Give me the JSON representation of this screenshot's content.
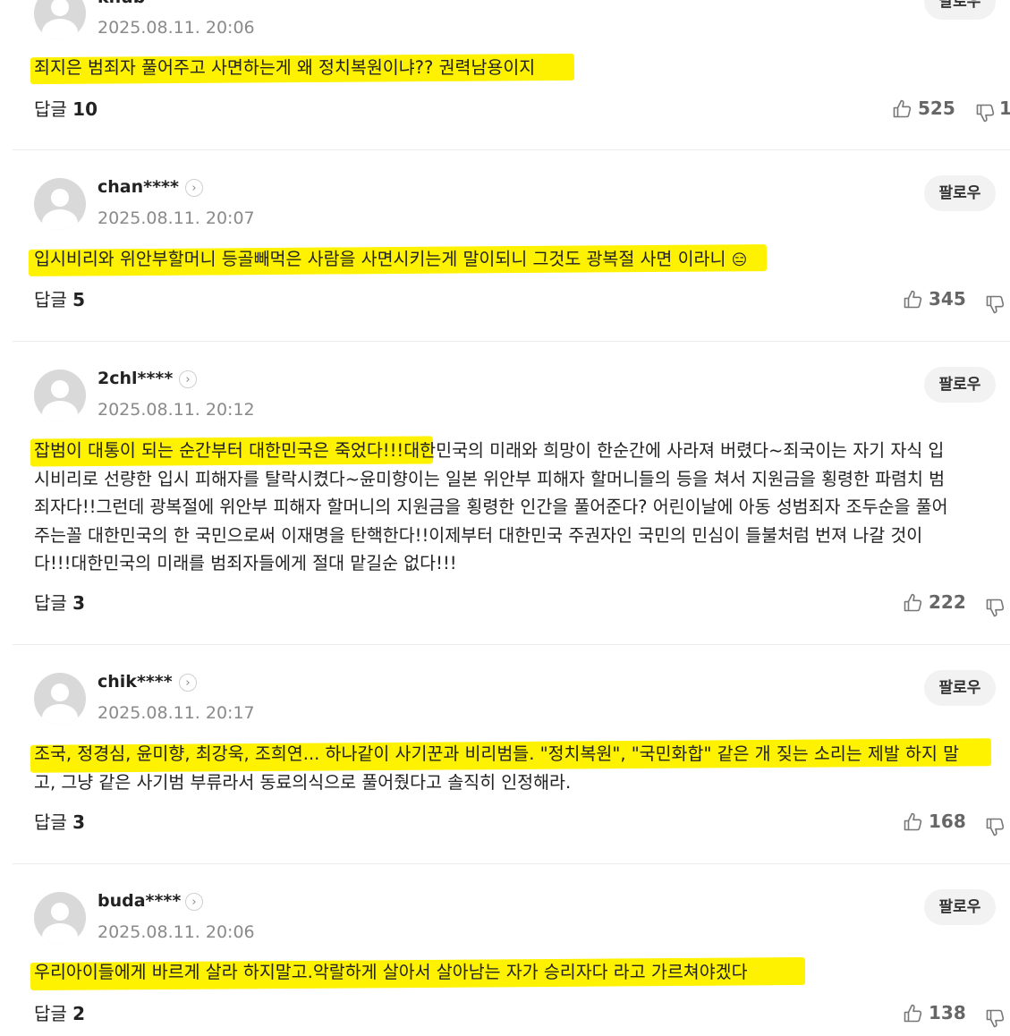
{
  "follow_label": "팔로우",
  "reply_label": "답글",
  "comments": [
    {
      "nickname": "khub",
      "time": "2025.08.11. 20:06",
      "text": "죄지은 범죄자 풀어주고 사면하는게 왜 정치복원이냐?? 권력남용이지",
      "replies": "10",
      "likes": "525",
      "dislikes": "1"
    },
    {
      "nickname": "chan****",
      "time": "2025.08.11. 20:07",
      "text": "입시비리와 위안부할머니 등골빼먹은 사람을 사면시키는게 말이되니 그것도 광복절 사면 이라니",
      "emoji": "😑",
      "replies": "5",
      "likes": "345"
    },
    {
      "nickname": "2chl****",
      "time": "2025.08.11. 20:12",
      "lines": [
        "잡범이 대통이 되는 순간부터 대한민국은 죽었다!!!대한민국의 미래와 희망이 한순간에 사라져 버렸다~죄국이는 자기 자식 입",
        "시비리로 선량한 입시 피해자를 탈락시켰다~윤미향이는 일본 위안부 피해자 할머니들의 등을 쳐서 지원금을 횡령한 파렴치 범",
        "죄자다!!그런데 광복절에 위안부 피해자 할머니의 지원금을 횡령한 인간을 풀어준다? 어린이날에 아동 성범죄자 조두순을 풀어",
        "주는꼴 대한민국의 한 국민으로써 이재명을 탄핵한다!!이제부터 대한민국 주권자인 국민의 민심이 들불처럼 번져 나갈 것이",
        "다!!!대한민국의 미래를 범죄자들에게 절대 맡길순 없다!!!"
      ],
      "replies": "3",
      "likes": "222"
    },
    {
      "nickname": "chik****",
      "time": "2025.08.11. 20:17",
      "lines": [
        "조국, 정경심, 윤미향, 최강욱, 조희연... 하나같이 사기꾼과 비리범들. \"정치복원\", \"국민화합\" 같은 개 짖는 소리는 제발 하지 말",
        "고, 그냥 같은 사기범 부류라서 동료의식으로 풀어줬다고 솔직히 인정해라."
      ],
      "replies": "3",
      "likes": "168"
    },
    {
      "nickname": "buda****",
      "time": "2025.08.11. 20:06",
      "text": "우리아이들에게 바르게 살라 하지말고.악랄하게 살아서 살아남는 자가 승리자다 라고 가르쳐야겠다",
      "replies": "2",
      "likes": "138"
    }
  ]
}
